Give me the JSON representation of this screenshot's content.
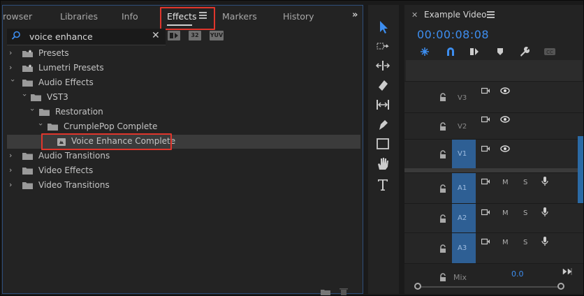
{
  "effects_panel": {
    "tabs": [
      "rowser",
      "Libraries",
      "Info",
      "Effects",
      "Markers",
      "History"
    ],
    "overflow_label": "»",
    "search": {
      "value": "voice enhance",
      "placeholder": ""
    },
    "filter_badges": [
      "",
      "32",
      "YUV"
    ],
    "tree": [
      {
        "label": "Presets",
        "level": 0,
        "expanded": false,
        "icon": "folder-star-icon"
      },
      {
        "label": "Lumetri Presets",
        "level": 0,
        "expanded": false,
        "icon": "folder-star-icon"
      },
      {
        "label": "Audio Effects",
        "level": 0,
        "expanded": true,
        "icon": "folder-icon"
      },
      {
        "label": "VST3",
        "level": 1,
        "expanded": true,
        "icon": "folder-icon"
      },
      {
        "label": "Restoration",
        "level": 2,
        "expanded": true,
        "icon": "folder-icon"
      },
      {
        "label": "CrumplePop Complete",
        "level": 3,
        "expanded": true,
        "icon": "folder-icon"
      },
      {
        "label": "Voice Enhance Complete",
        "level": 4,
        "expanded": null,
        "icon": "effect-icon",
        "selected": true
      },
      {
        "label": "Audio Transitions",
        "level": 0,
        "expanded": false,
        "icon": "folder-icon"
      },
      {
        "label": "Video Effects",
        "level": 0,
        "expanded": false,
        "icon": "folder-icon"
      },
      {
        "label": "Video Transitions",
        "level": 0,
        "expanded": false,
        "icon": "folder-icon"
      }
    ]
  },
  "tools": [
    "selection-tool-icon",
    "track-select-tool-icon",
    "ripple-edit-tool-icon",
    "razor-tool-icon",
    "slip-tool-icon",
    "pen-tool-icon",
    "rectangle-tool-icon",
    "hand-tool-icon",
    "type-tool-icon"
  ],
  "timeline": {
    "title": "Example Video",
    "timecode": "00:00:08:08",
    "tracks": [
      {
        "name": "V3",
        "type": "video",
        "targeted": false
      },
      {
        "name": "V2",
        "type": "video",
        "targeted": false
      },
      {
        "name": "V1",
        "type": "video",
        "targeted": true
      },
      {
        "name": "A1",
        "type": "audio",
        "targeted": true
      },
      {
        "name": "A2",
        "type": "audio",
        "targeted": true
      },
      {
        "name": "A3",
        "type": "audio",
        "targeted": true
      }
    ],
    "mute_label": "M",
    "solo_label": "S",
    "mix_label": "Mix",
    "mix_value": "0.0"
  },
  "colors": {
    "accent": "#3d8ef0",
    "highlight": "#e0362c",
    "target": "#2e5f94"
  }
}
